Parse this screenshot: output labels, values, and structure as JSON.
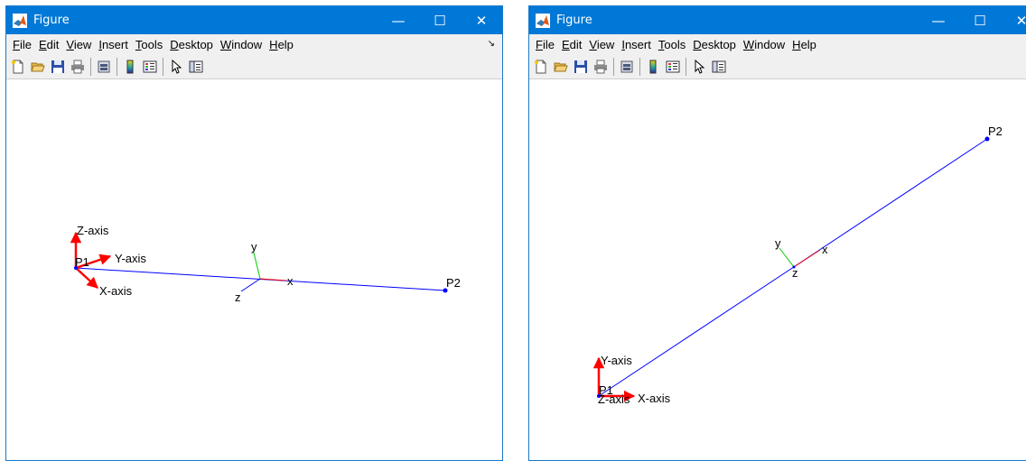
{
  "windows": [
    {
      "title": "Figure",
      "controls": {
        "minimize": "—",
        "maximize": "☐",
        "close": "✕"
      },
      "menu": [
        {
          "mnemonic": "F",
          "rest": "ile"
        },
        {
          "mnemonic": "E",
          "rest": "dit"
        },
        {
          "mnemonic": "V",
          "rest": "iew"
        },
        {
          "mnemonic": "I",
          "rest": "nsert"
        },
        {
          "mnemonic": "T",
          "rest": "ools"
        },
        {
          "mnemonic": "D",
          "rest": "esktop"
        },
        {
          "mnemonic": "W",
          "rest": "indow"
        },
        {
          "mnemonic": "H",
          "rest": "elp"
        }
      ],
      "dock_glyph": "↘",
      "plot": {
        "line_color": "#0000ff",
        "global_axes_color": "#ff0000",
        "labels": {
          "z_axis": "Z-axis",
          "y_axis": "Y-axis",
          "x_axis": "X-axis",
          "p1": "P1",
          "p2": "P2",
          "local_y": "y",
          "local_x": "x",
          "local_z": "z"
        }
      }
    },
    {
      "title": "Figure",
      "controls": {
        "minimize": "—",
        "maximize": "☐",
        "close": "✕"
      },
      "menu": [
        {
          "mnemonic": "F",
          "rest": "ile"
        },
        {
          "mnemonic": "E",
          "rest": "dit"
        },
        {
          "mnemonic": "V",
          "rest": "iew"
        },
        {
          "mnemonic": "I",
          "rest": "nsert"
        },
        {
          "mnemonic": "T",
          "rest": "ools"
        },
        {
          "mnemonic": "D",
          "rest": "esktop"
        },
        {
          "mnemonic": "W",
          "rest": "indow"
        },
        {
          "mnemonic": "H",
          "rest": "elp"
        }
      ],
      "plot": {
        "line_color": "#0000ff",
        "global_axes_color": "#ff0000",
        "labels": {
          "y_axis": "Y-axis",
          "z_axis": "Z-axis",
          "x_axis": "X-axis",
          "p1": "P1",
          "p2": "P2",
          "local_y": "y",
          "local_x": "x",
          "local_z": "z"
        }
      }
    }
  ],
  "toolbar_icons": [
    "new-figure-icon",
    "open-file-icon",
    "save-icon",
    "print-icon",
    "print-preview-icon",
    "colorbar-icon",
    "legend-icon",
    "pointer-icon",
    "property-inspector-icon"
  ]
}
